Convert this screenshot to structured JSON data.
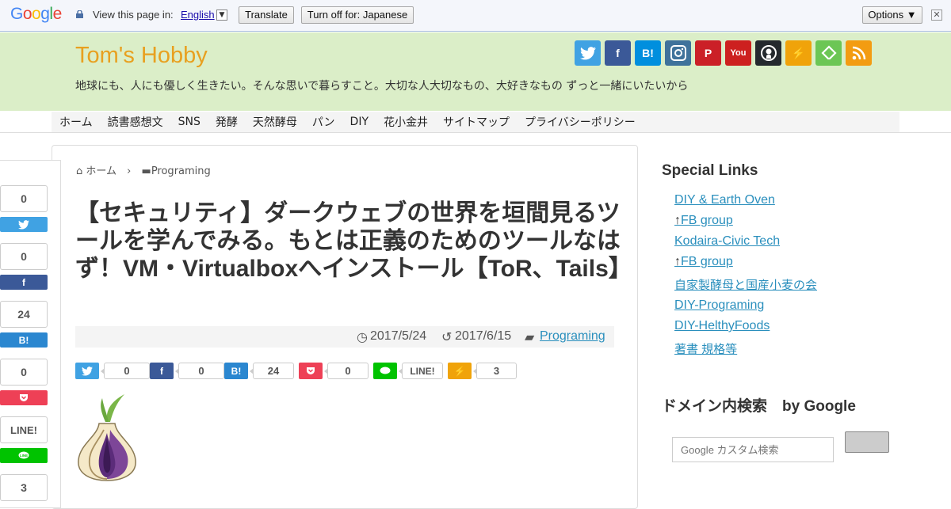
{
  "toolbar": {
    "label": "View this page in:",
    "language": "English",
    "translate": "Translate",
    "turn_off": "Turn off for: Japanese",
    "options": "Options ▼",
    "close": "✕"
  },
  "site": {
    "title": "Tom's Hobby",
    "tagline": "地球にも、人にも優しく生きたい。そんな思いで暮らすこと。大切な人大切なもの、大好きなもの ずっと一緒にいたいから"
  },
  "social_icons": [
    {
      "name": "twitter-icon",
      "label": "",
      "color": "#40a2e3"
    },
    {
      "name": "facebook-icon",
      "label": "f",
      "color": "#3b5998"
    },
    {
      "name": "hatena-icon",
      "label": "B!",
      "color": "#008fde"
    },
    {
      "name": "instagram-icon",
      "label": "",
      "color": "#3f729b"
    },
    {
      "name": "pinterest-icon",
      "label": "P",
      "color": "#cb2027"
    },
    {
      "name": "youtube-icon",
      "label": "You",
      "color": "#cd201f"
    },
    {
      "name": "github-icon",
      "label": "",
      "color": "#24292e"
    },
    {
      "name": "feedly-flash-icon",
      "label": "⚡",
      "color": "#f0a30a"
    },
    {
      "name": "feedly-icon",
      "label": "",
      "color": "#6cc655"
    },
    {
      "name": "rss-icon",
      "label": "",
      "color": "#f39c12"
    }
  ],
  "nav": [
    "ホーム",
    "読書感想文",
    "SNS",
    "発酵",
    "天然酵母",
    "パン",
    "DIY",
    "花小金井",
    "サイトマップ",
    "プライバシーポリシー"
  ],
  "breadcrumb": {
    "home": "ホーム",
    "category": "Programing"
  },
  "article": {
    "title": "【セキュリティ】ダークウェブの世界を垣間見るツールを学んでみる。もとは正義のためのツールなはず！VM・Virtualboxへインストール【ToR、Tails】",
    "published": "2017/5/24",
    "updated": "2017/6/15",
    "category": "Programing"
  },
  "share_counts": {
    "twitter": "0",
    "facebook": "0",
    "hatena": "24",
    "pocket": "0",
    "line": "LINE!",
    "feedly": "3"
  },
  "sidebar": {
    "special_title": "Special Links",
    "links": [
      {
        "prefix": "",
        "text": "DIY & Earth Oven"
      },
      {
        "prefix": "↑",
        "text": "FB group"
      },
      {
        "prefix": "",
        "text": "Kodaira-Civic Tech"
      },
      {
        "prefix": "↑",
        "text": "FB group"
      },
      {
        "prefix": "",
        "text": "自家製酵母と国産小麦の会"
      },
      {
        "prefix": "",
        "text": "DIY-Programing"
      },
      {
        "prefix": "",
        "text": "DIY-HelthyFoods"
      },
      {
        "prefix": "",
        "text": "著書 規格等"
      }
    ],
    "search_title": "ドメイン内検索　by Google",
    "search_placeholder": "Google カスタム検索"
  }
}
